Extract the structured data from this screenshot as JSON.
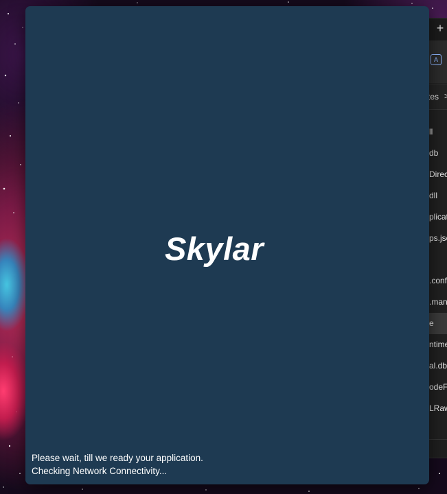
{
  "splash": {
    "logo_text": "Skylar",
    "status_line_1": "Please wait, till we ready your application.",
    "status_line_2": "Checking Network Connectivity...",
    "background_color": "#1e3a52"
  },
  "background_window": {
    "new_tab_label": "+",
    "toolbar_icon": "translate-icon",
    "path_text": "tes",
    "path_chevron": ">",
    "files": [
      {
        "name": "ll",
        "selected": false
      },
      {
        "name": "db",
        "selected": false
      },
      {
        "name": "Direc",
        "selected": false
      },
      {
        "name": "dll",
        "selected": false
      },
      {
        "name": "plicat",
        "selected": false
      },
      {
        "name": "ps.jsc",
        "selected": false
      },
      {
        "name": "",
        "selected": false
      },
      {
        "name": ".conf",
        "selected": false
      },
      {
        "name": ".man",
        "selected": false
      },
      {
        "name": "e",
        "selected": true
      },
      {
        "name": "ntime",
        "selected": false
      },
      {
        "name": "al.db",
        "selected": false
      },
      {
        "name": "odeFi",
        "selected": false
      },
      {
        "name": "LRaw",
        "selected": false
      }
    ]
  }
}
